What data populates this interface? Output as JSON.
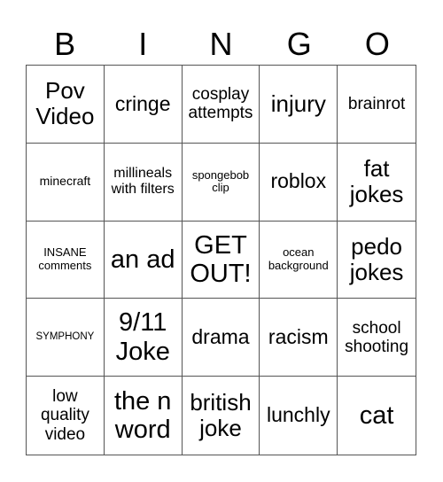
{
  "header": [
    "B",
    "I",
    "N",
    "G",
    "O"
  ],
  "cells": [
    {
      "text": "Pov Video",
      "size": "s-lg"
    },
    {
      "text": "cringe",
      "size": "s-md"
    },
    {
      "text": "cosplay attempts",
      "size": "s-sm"
    },
    {
      "text": "injury",
      "size": "s-lg"
    },
    {
      "text": "brainrot",
      "size": "s-sm"
    },
    {
      "text": "minecraft",
      "size": "s-xxs"
    },
    {
      "text": "millineals with filters",
      "size": "s-xs"
    },
    {
      "text": "spongebob clip",
      "size": "s-tiny"
    },
    {
      "text": "roblox",
      "size": "s-md"
    },
    {
      "text": "fat jokes",
      "size": "s-lg"
    },
    {
      "text": "INSANE comments",
      "size": "s-tiny"
    },
    {
      "text": "an ad",
      "size": "s-xl"
    },
    {
      "text": "GET OUT!",
      "size": "s-xl"
    },
    {
      "text": "ocean background",
      "size": "s-tiny"
    },
    {
      "text": "pedo jokes",
      "size": "s-lg"
    },
    {
      "text": "SYMPHONY",
      "size": "s-min"
    },
    {
      "text": "9/11 Joke",
      "size": "s-xl"
    },
    {
      "text": "drama",
      "size": "s-md"
    },
    {
      "text": "racism",
      "size": "s-md"
    },
    {
      "text": "school shooting",
      "size": "s-sm"
    },
    {
      "text": "low quality video",
      "size": "s-sm"
    },
    {
      "text": "the n word",
      "size": "s-xl"
    },
    {
      "text": "british joke",
      "size": "s-lg"
    },
    {
      "text": "lunchly",
      "size": "s-md"
    },
    {
      "text": "cat",
      "size": "s-xl"
    }
  ]
}
